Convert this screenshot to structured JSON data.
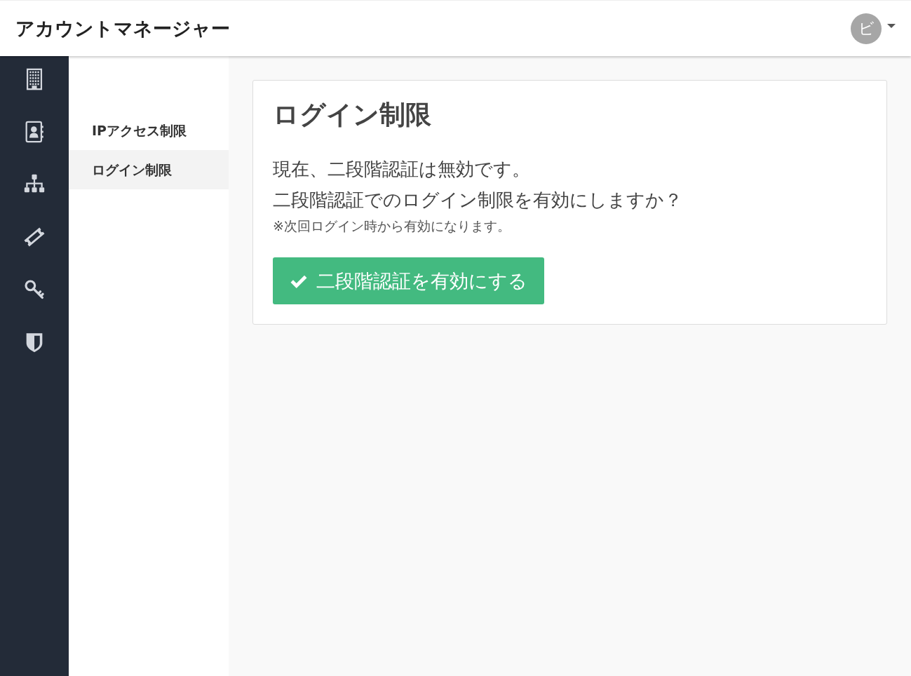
{
  "header": {
    "title": "アカウントマネージャー",
    "avatar": "ビ"
  },
  "rail": [
    {
      "kind": "building"
    },
    {
      "kind": "contacts"
    },
    {
      "kind": "sitemap"
    },
    {
      "kind": "ticket"
    },
    {
      "kind": "key"
    },
    {
      "kind": "shield"
    }
  ],
  "subnav": [
    {
      "label": "IPアクセス制限",
      "selected": false
    },
    {
      "label": "ログイン制限",
      "selected": true
    }
  ],
  "card": {
    "title": "ログイン制限",
    "lines": [
      "現在、二段階認証は無効です。",
      "二段階認証でのログイン制限を有効にしますか？"
    ],
    "note": "※次回ログイン時から有効になります。",
    "button": "二段階認証を有効にする"
  }
}
